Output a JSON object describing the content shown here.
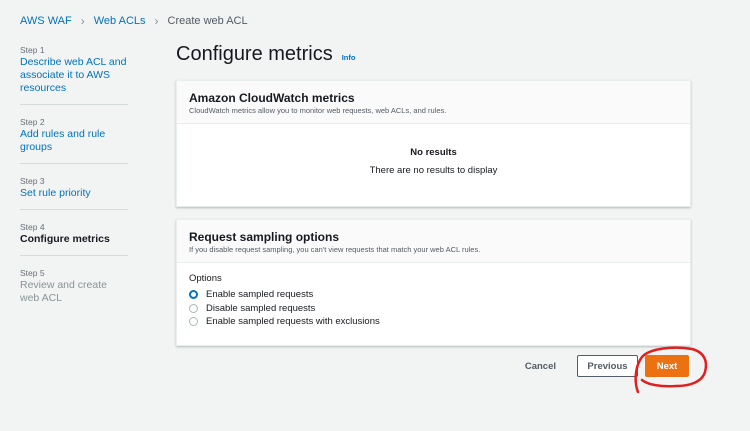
{
  "breadcrumb": {
    "items": [
      "AWS WAF",
      "Web ACLs"
    ],
    "current": "Create web ACL"
  },
  "steps": [
    {
      "num": "Step 1",
      "title": "Describe web ACL and associate it to AWS resources"
    },
    {
      "num": "Step 2",
      "title": "Add rules and rule groups"
    },
    {
      "num": "Step 3",
      "title": "Set rule priority"
    },
    {
      "num": "Step 4",
      "title": "Configure metrics"
    },
    {
      "num": "Step 5",
      "title": "Review and create web ACL"
    }
  ],
  "page": {
    "title": "Configure metrics",
    "info_label": "Info"
  },
  "cloudwatch": {
    "title": "Amazon CloudWatch metrics",
    "description": "CloudWatch metrics allow you to monitor web requests, web ACLs, and rules.",
    "empty_title": "No results",
    "empty_description": "There are no results to display"
  },
  "sampling": {
    "title": "Request sampling options",
    "description": "If you disable request sampling, you can't view requests that match your web ACL rules.",
    "options_label": "Options",
    "options": [
      "Enable sampled requests",
      "Disable sampled requests",
      "Enable sampled requests with exclusions"
    ],
    "selected": "Enable sampled requests"
  },
  "actions": {
    "cancel": "Cancel",
    "previous": "Previous",
    "next": "Next"
  },
  "colors": {
    "accent": "#ec7211",
    "link": "#0073bb",
    "annotation": "#e0201f"
  }
}
